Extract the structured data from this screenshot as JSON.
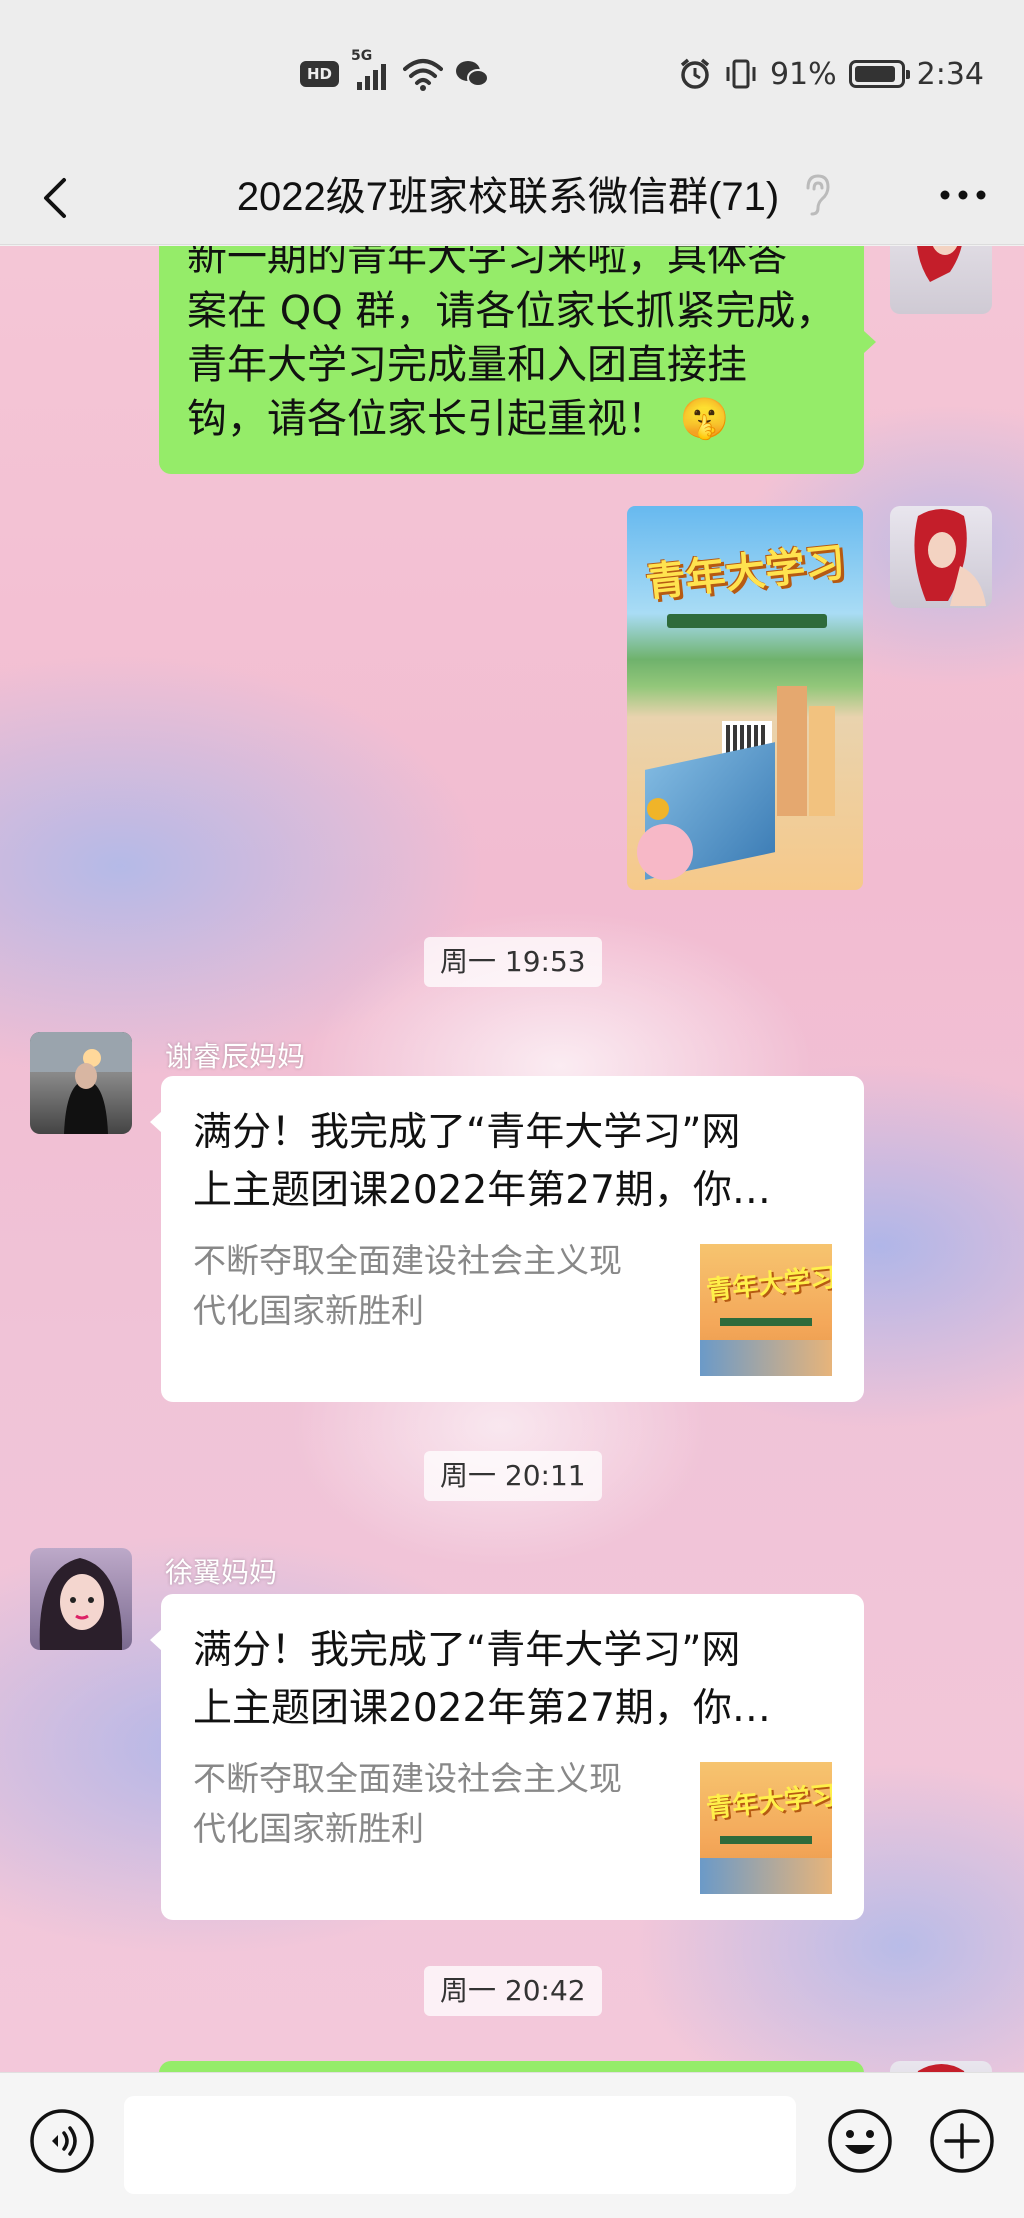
{
  "status_bar": {
    "hd": "HD",
    "network": "5G",
    "battery_percent": "91%",
    "battery_level": 0.91,
    "time": "2:34"
  },
  "nav": {
    "title": "2022级7班家校联系微信群(71)"
  },
  "messages": {
    "sent_text_lines": [
      "新一期的青年大学习来啦，具体答",
      "案在 QQ 群，请各位家长抓紧完成，",
      "青年大学习完成量和入团直接挂",
      "钩，请各位家长引起重视！"
    ],
    "sent_emoji": "🤫",
    "poster_title": "青年大学习",
    "time_1": "周一 19:53",
    "sender_1": "谢睿辰妈妈",
    "card_1": {
      "title_line1": "满分！我完成了“青年大学习”网",
      "title_line2": "上主题团课2022年第27期，你…",
      "desc_line1": "不断夺取全面建设社会主义现",
      "desc_line2": "代化国家新胜利",
      "thumb_title": "青年大学习"
    },
    "time_2": "周一 20:11",
    "sender_2": "徐翼妈妈",
    "card_2": {
      "title_line1": "满分！我完成了“青年大学习”网",
      "title_line2": "上主题团课2022年第27期，你…",
      "desc_line1": "不断夺取全面建设社会主义现",
      "desc_line2": "代化国家新胜利",
      "thumb_title": "青年大学习"
    },
    "time_3": "周一 20:42"
  },
  "colors": {
    "bubble_green": "#95ec69",
    "bar_bg": "#ededed"
  }
}
